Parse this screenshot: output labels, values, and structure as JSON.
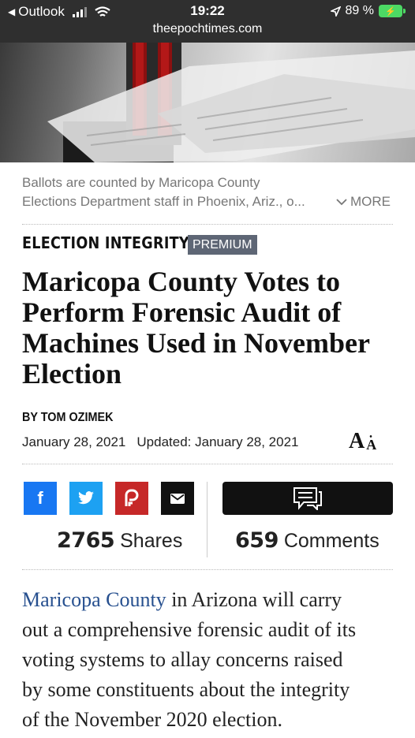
{
  "status_bar": {
    "back_app": "Outlook",
    "time": "19:22",
    "url": "theepochtimes.com",
    "battery": "89 %"
  },
  "icons": {
    "back": "back-arrow-icon",
    "signal": "signal-icon",
    "wifi": "wifi-icon",
    "location": "location-arrow-icon",
    "battery": "battery-charging-icon",
    "more": "chevron-down-icon",
    "facebook": "facebook-icon",
    "twitter": "twitter-icon",
    "parler": "parler-icon",
    "email": "email-icon",
    "comment": "comment-icon"
  },
  "caption": {
    "line1": "Ballots are counted by Maricopa County",
    "line2": "Elections Department staff in Phoenix, Ariz., o...",
    "more_label": "MORE"
  },
  "article": {
    "section": "ELECTION INTEGRITY",
    "badge": "PREMIUM",
    "headline_lines": [
      "Maricopa County Votes to",
      "Perform Forensic Audit of",
      "Machines Used in November",
      "Election"
    ],
    "byline": "BY TOM OZIMEK",
    "date": "January 28, 2021",
    "updated": "Updated: January 28, 2021",
    "font_size_label_large": "A",
    "font_size_label_small": "A"
  },
  "social": {
    "share_count": "2765",
    "share_label": "Shares",
    "comment_count": "659",
    "comment_label": "Comments",
    "facebook_glyph": "f"
  },
  "body": {
    "link_text": "Maricopa County",
    "line1_rest": " in Arizona will carry",
    "lines": [
      "out a comprehensive forensic audit of its",
      "voting systems to allay concerns raised",
      "by some constituents about the integrity",
      "of the November 2020 election."
    ]
  },
  "colors": {
    "status_bar": "#2f2f2f",
    "battery": "#4cd964",
    "premium_badge": "#5e6675",
    "facebook": "#1877f2",
    "twitter": "#1da1f2",
    "parler": "#c62828",
    "email": "#111111",
    "link": "#27508f"
  }
}
